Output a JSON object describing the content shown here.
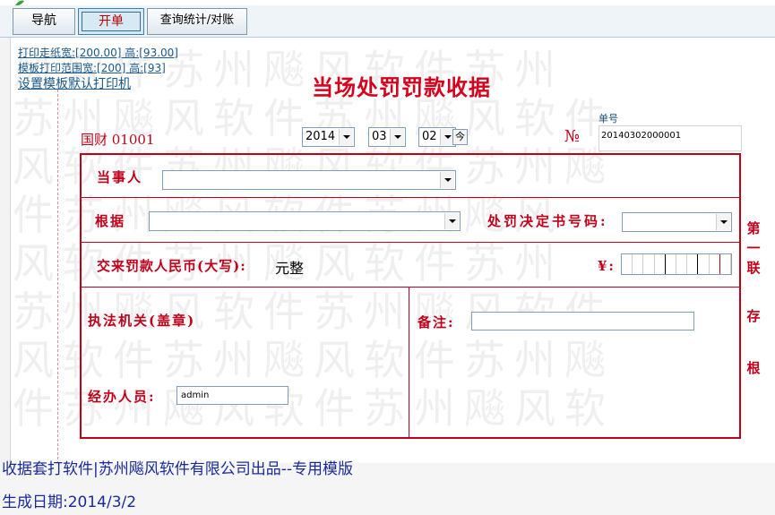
{
  "tabs": {
    "nav": "导航",
    "open": "开单",
    "query": "查询统计/对账"
  },
  "links": {
    "print_offset": "打印走纸宽:[200.00] 高:[93.00]",
    "template_range": "模板打印范围宽:[200] 高:[93]",
    "set_default_printer": "设置模板默认打印机"
  },
  "watermark": [
    "风软件苏州飚风软件苏州",
    "苏州飚风软件苏州飚风软件",
    "风软件苏州飚风软件苏州飚",
    "件苏州飚风软件苏州飚风",
    "风软件苏州飚风软件苏州",
    "苏州飚风软件苏州飚风软件",
    "风软件苏州飚风软件苏州飚",
    "件苏州飚风软件苏州飚风软"
  ],
  "receipt": {
    "title": "当场处罚罚款收据",
    "guocai": "国财 01001",
    "year": "2014",
    "month": "03",
    "day": "02",
    "today_button": "今",
    "no_mark": "№",
    "serial_label": "单号",
    "serial_value": "20140302000001",
    "party_label": "当事人",
    "party_value": "",
    "basis_label": "根据",
    "basis_value": "",
    "decision_label": "处罚决定书号码:",
    "decision_value": "",
    "amount_label": "交来罚款人民币(大写):",
    "amount_suffix": "元整",
    "yen_label": "¥:",
    "agency_label": "执法机关(盖章)",
    "remark_label": "备注:",
    "remark_value": "",
    "handler_label": "经办人员:",
    "handler_value": "admin",
    "side_text": [
      "第",
      "一",
      "联",
      "存",
      "根"
    ]
  },
  "footer": {
    "line1": "收据套打软件|苏州飚风软件有限公司出品--专用模版",
    "line2": "生成日期:2014/3/2"
  },
  "colors": {
    "form_red": "#c0001a",
    "title_red": "#d6001c",
    "link_blue": "#1a5a8c",
    "footer_blue": "#1a2a9c"
  }
}
